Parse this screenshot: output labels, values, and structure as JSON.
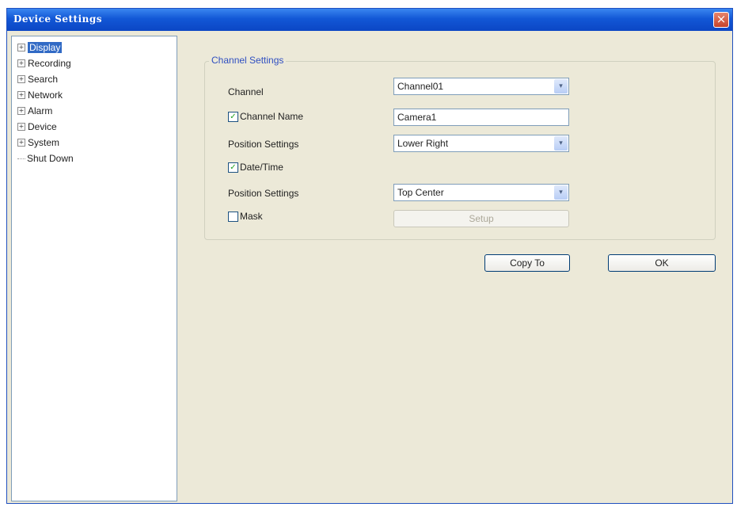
{
  "window": {
    "title": "Device Settings",
    "close_label": "×"
  },
  "tree": {
    "items": [
      {
        "label": "Display",
        "expander": "+",
        "selected": true
      },
      {
        "label": "Recording",
        "expander": "+"
      },
      {
        "label": "Search",
        "expander": "+"
      },
      {
        "label": "Network",
        "expander": "+"
      },
      {
        "label": "Alarm",
        "expander": "+"
      },
      {
        "label": "Device",
        "expander": "+"
      },
      {
        "label": "System",
        "expander": "+"
      },
      {
        "label": "Shut Down"
      }
    ]
  },
  "channel_settings": {
    "group_title": "Channel Settings",
    "channel_label": "Channel",
    "channel_value": "Channel01",
    "channel_name_label": "Channel Name",
    "channel_name_checked": "✓",
    "channel_name_value": "Camera1",
    "position1_label": "Position Settings",
    "position1_value": "Lower Right",
    "datetime_label": "Date/Time",
    "datetime_checked": "✓",
    "position2_label": "Position Settings",
    "position2_value": "Top Center",
    "mask_label": "Mask",
    "mask_checked": "",
    "setup_label": "Setup",
    "dropdown_arrow": "▾"
  },
  "buttons": {
    "copy_to": "Copy To",
    "ok": "OK"
  }
}
